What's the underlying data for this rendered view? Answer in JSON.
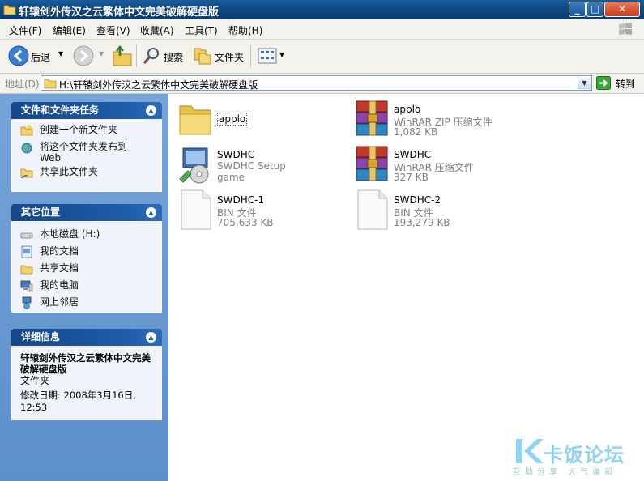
{
  "window": {
    "title": "轩辕剑外传汉之云繁体中文完美破解硬盘版",
    "controls": {
      "minimize": "_",
      "maximize": "□",
      "close": "✕"
    }
  },
  "menubar": {
    "items": [
      "文件(F)",
      "编辑(E)",
      "查看(V)",
      "收藏(A)",
      "工具(T)",
      "帮助(H)"
    ]
  },
  "toolbar": {
    "back_label": "后退",
    "search_label": "搜索",
    "folders_label": "文件夹"
  },
  "addressbar": {
    "label": "地址(D)",
    "path": "H:\\轩辕剑外传汉之云繁体中文完美破解硬盘版",
    "go_label": "转到"
  },
  "taskpane": {
    "file_tasks": {
      "title": "文件和文件夹任务",
      "items": [
        {
          "label": "创建一个新文件夹",
          "icon": "new-folder-icon"
        },
        {
          "label": "将这个文件夹发布到\nWeb",
          "icon": "publish-web-icon"
        },
        {
          "label": "共享此文件夹",
          "icon": "share-folder-icon"
        }
      ]
    },
    "other_places": {
      "title": "其它位置",
      "items": [
        {
          "label": "本地磁盘 (H:)",
          "icon": "local-disk-icon"
        },
        {
          "label": "我的文档",
          "icon": "my-documents-icon"
        },
        {
          "label": "共享文档",
          "icon": "shared-documents-icon"
        },
        {
          "label": "我的电脑",
          "icon": "my-computer-icon"
        },
        {
          "label": "网上邻居",
          "icon": "network-places-icon"
        }
      ]
    },
    "details": {
      "title": "详细信息",
      "name": "轩辕剑外传汉之云繁体中文完美破解硬盘版",
      "type": "文件夹",
      "modified": "修改日期: 2008年3月16日, 12:53"
    }
  },
  "files": [
    {
      "name": "applo",
      "line2": "",
      "line3": "",
      "icon": "folder-icon",
      "selected": true
    },
    {
      "name": "applo",
      "line2": "WinRAR ZIP 压缩文件",
      "line3": "1,082 KB",
      "icon": "winrar-zip-icon"
    },
    {
      "name": "SWDHC",
      "line2": "SWDHC Setup",
      "line3": "game",
      "icon": "setup-icon"
    },
    {
      "name": "SWDHC",
      "line2": "WinRAR 压缩文件",
      "line3": "327 KB",
      "icon": "winrar-icon"
    },
    {
      "name": "SWDHC-1",
      "line2": "BIN 文件",
      "line3": "705,633 KB",
      "icon": "blank-file-icon"
    },
    {
      "name": "SWDHC-2",
      "line2": "BIN 文件",
      "line3": "193,279 KB",
      "icon": "blank-file-icon"
    }
  ],
  "watermark": {
    "title": "卡饭论坛",
    "slogan": "互助分享  大气谦和"
  },
  "colors": {
    "titlebar": "#0f4a85",
    "taskpane": "#6b9bd2",
    "panel_header": "#1d5aa6"
  }
}
